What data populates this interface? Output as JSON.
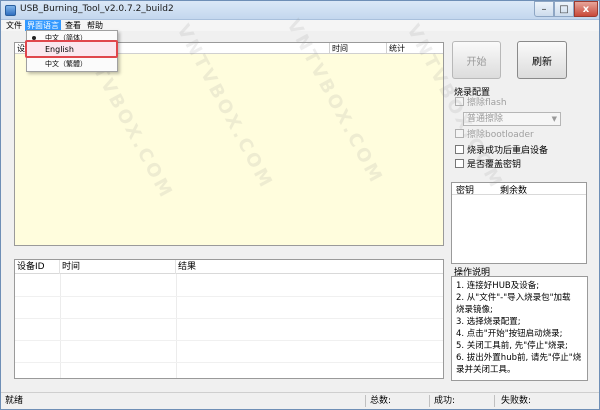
{
  "window": {
    "title": "USB_Burning_Tool_v2.0.7.2_build2",
    "controls": {
      "minimize": "–",
      "maximize": "□",
      "close": "x"
    }
  },
  "menu": {
    "items": [
      {
        "label": "文件"
      },
      {
        "label": "界面语言"
      },
      {
        "label": "查看"
      },
      {
        "label": "帮助"
      }
    ],
    "language_options": [
      {
        "label": "中文（简体）"
      },
      {
        "label": "English"
      },
      {
        "label": "中文（繁體）"
      }
    ]
  },
  "log_table": {
    "columns": [
      "设备",
      "时间",
      "统计"
    ]
  },
  "buttons": {
    "start": "开始",
    "refresh": "刷新"
  },
  "burn_config": {
    "title": "烧录配置",
    "erase_flash": "擦除flash",
    "erase_mode": "普通擦除",
    "erase_bootloader": "擦除bootloader",
    "reboot_after": "烧录成功后重启设备",
    "overwrite_key": "是否覆盖密钥"
  },
  "key_table": {
    "columns": [
      "密钥",
      "剩余数"
    ]
  },
  "result_table": {
    "columns": [
      "设备ID",
      "时间",
      "结果"
    ]
  },
  "instructions": {
    "title": "操作说明",
    "lines": [
      "1. 连接好HUB及设备;",
      "2. 从\"文件\"-\"导入烧录包\"加载",
      "烧录镜像;",
      "3. 选择烧录配置;",
      "4. 点击\"开始\"按钮启动烧录;",
      "5. 关闭工具前, 先\"停止\"烧录;",
      "6. 拔出外置hub前, 请先\"停止\"烧",
      "录并关闭工具。"
    ]
  },
  "status": {
    "state": "就绪",
    "total_label": "总数:",
    "success_label": "成功:",
    "fail_label": "失败数:"
  },
  "watermark": "VNTVBOX.COM"
}
